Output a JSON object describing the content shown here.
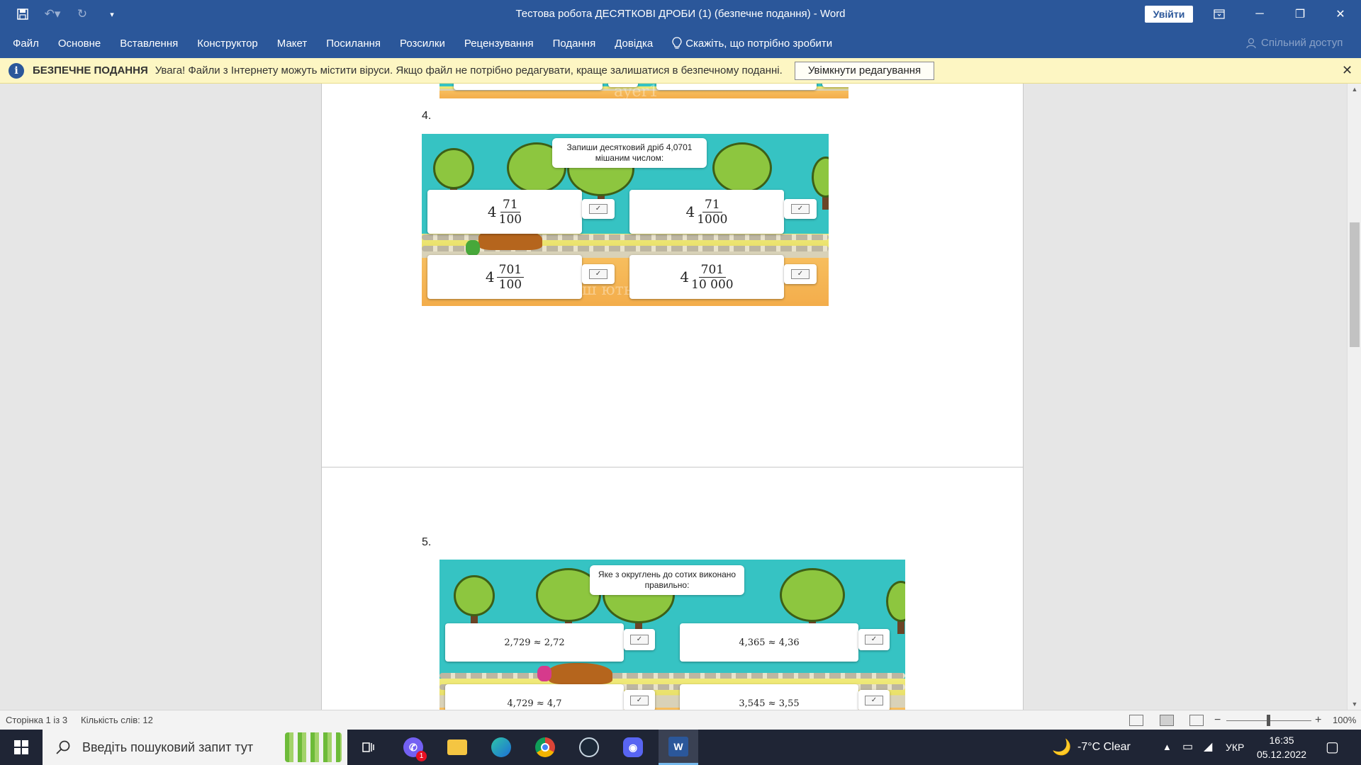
{
  "titlebar": {
    "title": "Тестова робота ДЕСЯТКОВІ ДРОБИ (1) (безпечне подання)  -  Word",
    "signin_label": "Увійти"
  },
  "ribbon": {
    "tabs": [
      "Файл",
      "Основне",
      "Вставлення",
      "Конструктор",
      "Макет",
      "Посилання",
      "Розсилки",
      "Рецензування",
      "Подання",
      "Довідка"
    ],
    "tell_me": "Скажіть, що потрібно зробити",
    "share": "Спільний доступ"
  },
  "protected_bar": {
    "title": "БЕЗПЕЧНЕ ПОДАННЯ",
    "message": "Увага! Файли з Інтернету можуть містити віруси. Якщо файл не потрібно редагувати, краще залишатися в безпечному поданні.",
    "enable_button": "Увімкнути редагування"
  },
  "question4": {
    "number": "4.",
    "prompt": "Запиши десятковий дріб 4,0701 мішаним числом:",
    "answers": [
      {
        "whole": "4",
        "num": "71",
        "den": "100"
      },
      {
        "whole": "4",
        "num": "71",
        "den": "1000"
      },
      {
        "whole": "4",
        "num": "701",
        "den": "100"
      },
      {
        "whole": "4",
        "num": "701",
        "den": "10 000"
      }
    ],
    "watermark": "ш ють"
  },
  "question5": {
    "number": "5.",
    "prompt": "Яке з округлень до сотих виконано правильно:",
    "answers": [
      "2,729 ≈ 2,72",
      "4,365 ≈ 4,36",
      "4,729 ≈ 4,7",
      "3,545 ≈ 3,55"
    ]
  },
  "top_image_watermark": "ayer1",
  "check_mark": "✓",
  "status": {
    "page": "Сторінка 1 із 3",
    "words": "Кількість слів: 12",
    "zoom": "100%"
  },
  "taskbar": {
    "search_placeholder": "Введіть пошуковий запит тут",
    "viber_badge": "1",
    "weather": "-7°C  Clear",
    "language": "УКР",
    "time": "16:35",
    "date": "05.12.2022"
  },
  "colors": {
    "word_blue": "#2b579a",
    "protected_bar": "#fdf6c3",
    "sky": "#36c3c3",
    "tree_green": "#8dc63f",
    "track_orange": "#f7be5e"
  }
}
